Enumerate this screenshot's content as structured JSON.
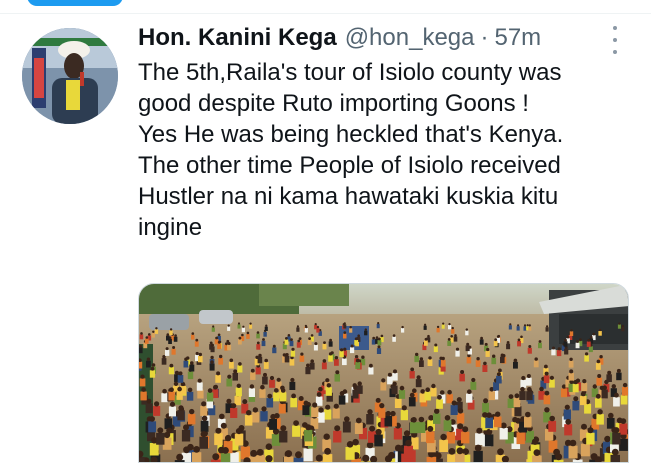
{
  "tweet": {
    "display_name": "Hon. Kanini Kega",
    "handle": "@hon_kega",
    "separator": "·",
    "time": "57m",
    "lines": [
      "The 5th,Raila's tour of Isiolo county was",
      "good despite Ruto importing Goons !",
      "Yes He was being heckled that's Kenya.",
      "The other time People of Isiolo received",
      "Hustler na ni kama hawataki kuskia kitu",
      "ingine"
    ]
  },
  "icons": {
    "more": "more-vertical-icon"
  },
  "colors": {
    "accent": "#1d9bf0",
    "secondary_text": "#536471",
    "primary_text": "#0f1419"
  }
}
